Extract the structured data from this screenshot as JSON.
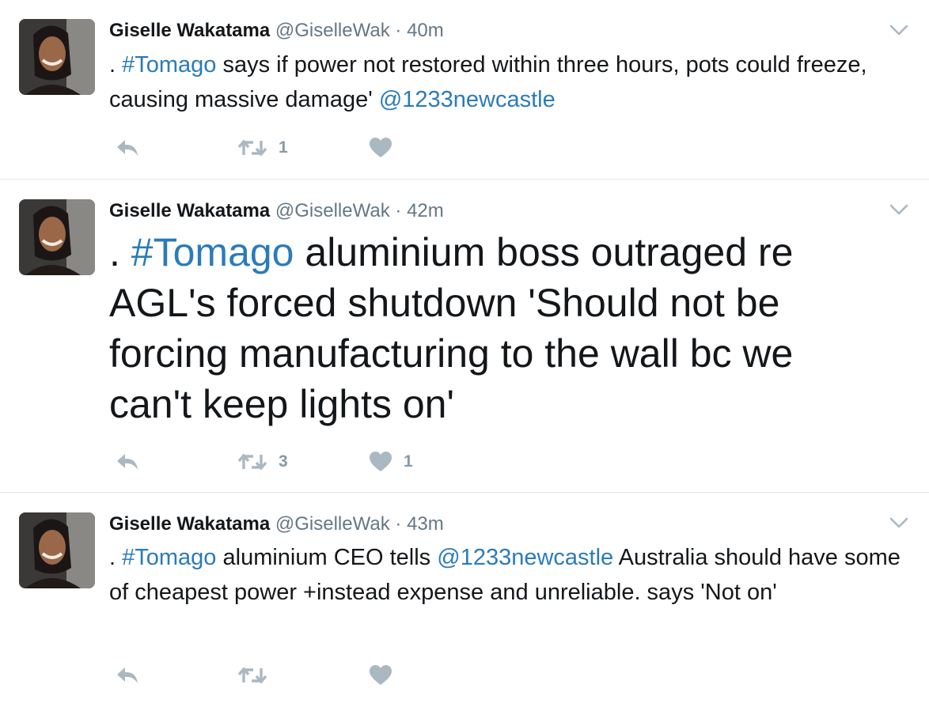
{
  "colors": {
    "link": "#2b7bb9",
    "muted": "#657786",
    "icon": "#aab8c2",
    "divider": "#e1e8ed"
  },
  "tweets": [
    {
      "name": "Giselle Wakatama",
      "handle": "@GiselleWak",
      "separator": "·",
      "time": "40m",
      "segments": [
        {
          "text": ". ",
          "link": false
        },
        {
          "text": "#Tomago",
          "link": true
        },
        {
          "text": " says if power not restored within three hours, pots could freeze, causing massive damage'   ",
          "link": false
        },
        {
          "text": "@1233newcastle",
          "link": true
        }
      ],
      "retweet_count": "1",
      "like_count": ""
    },
    {
      "name": "Giselle Wakatama",
      "handle": "@GiselleWak",
      "separator": "·",
      "time": "42m",
      "segments": [
        {
          "text": ". ",
          "link": false
        },
        {
          "text": "#Tomago",
          "link": true
        },
        {
          "text": " aluminium boss outraged re AGL's forced shutdown 'Should not be forcing manufacturing to the wall bc we can't keep lights on'",
          "link": false
        }
      ],
      "retweet_count": "3",
      "like_count": "1"
    },
    {
      "name": "Giselle Wakatama",
      "handle": "@GiselleWak",
      "separator": "·",
      "time": "43m",
      "segments": [
        {
          "text": ". ",
          "link": false
        },
        {
          "text": "#Tomago",
          "link": true
        },
        {
          "text": " aluminium CEO tells ",
          "link": false
        },
        {
          "text": "@1233newcastle",
          "link": true
        },
        {
          "text": " Australia should have some of cheapest power +instead expense and unreliable. says 'Not on'",
          "link": false
        }
      ],
      "retweet_count": "",
      "like_count": ""
    }
  ],
  "icons": {
    "reply": "reply-icon",
    "retweet": "retweet-icon",
    "like": "heart-icon",
    "more": "chevron-down-icon"
  }
}
